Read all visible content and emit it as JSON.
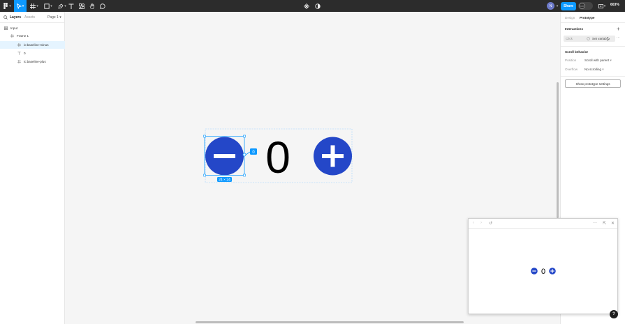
{
  "toolbar": {
    "share_label": "Share",
    "zoom_label": "603%",
    "user_initial": "N"
  },
  "left_panel": {
    "tab_layers": "Layers",
    "tab_assets": "Assets",
    "page_selector": "Page 1",
    "layers": [
      {
        "label": "Input",
        "type": "page"
      },
      {
        "label": "Frame 1",
        "type": "frame"
      },
      {
        "label": "ic:baseline-minus",
        "type": "component",
        "selected": true
      },
      {
        "label": "0",
        "type": "text"
      },
      {
        "label": "ic:baseline-plus",
        "type": "component"
      }
    ]
  },
  "canvas": {
    "counter_value": "0",
    "size_badge": "24 × 24",
    "connector_badge": "0"
  },
  "right_panel": {
    "tab_design": "Design",
    "tab_prototype": "Prototype",
    "interactions_title": "Interactions",
    "interaction_trigger": "Click",
    "interaction_action": "Set variab",
    "scroll_title": "Scroll behavior",
    "position_label": "Position",
    "position_value": "Scroll with parent",
    "overflow_label": "Overflow",
    "overflow_value": "No scrolling",
    "prototype_settings_button": "Show prototype settings"
  },
  "preview": {
    "counter_value": "0"
  },
  "colors": {
    "accent": "#0d99ff",
    "button_fill": "#2447c8",
    "toolbar_bg": "#2c2c2c"
  },
  "help_label": "?"
}
